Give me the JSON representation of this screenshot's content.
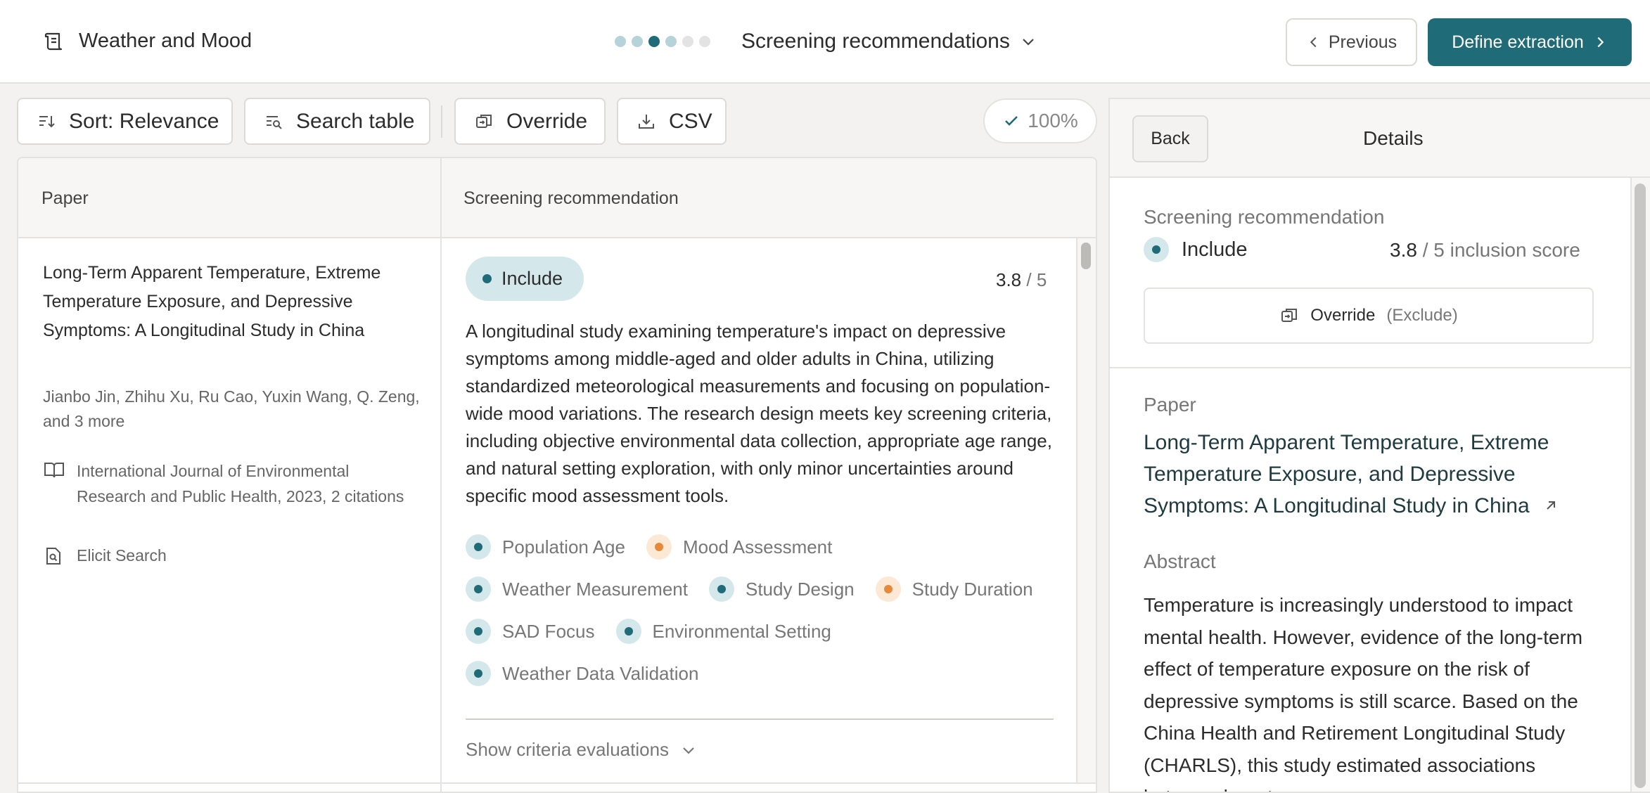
{
  "header": {
    "app_title": "Weather and Mood",
    "stage": "Screening recommendations",
    "steps": [
      "done",
      "done",
      "active",
      "done",
      "todo",
      "todo"
    ],
    "previous_label": "Previous",
    "next_label": "Define extraction"
  },
  "toolbar": {
    "sort_label": "Sort: Relevance",
    "search_label": "Search table",
    "override_label": "Override",
    "csv_label": "CSV",
    "progress": "100%"
  },
  "table": {
    "headers": [
      "Paper",
      "Screening recommendation"
    ],
    "row": {
      "title": "Long-Term Apparent Temperature, Extreme Temperature Exposure, and Depressive Symptoms: A Longitudinal Study in China",
      "authors": "Jianbo Jin, Zhihu Xu, Ru Cao, Yuxin Wang, Q. Zeng, and 3 more",
      "journal": "International Journal of Environmental Research and Public Health, 2023, 2 citations",
      "source": "Elicit Search",
      "recommendation": "Include",
      "score": "3.8",
      "score_max": "/ 5",
      "summary": "A longitudinal study examining temperature's impact on depressive symptoms among middle-aged and older adults in China, utilizing standardized meteorological measurements and focusing on population-wide mood variations. The research design meets key screening criteria, including objective environmental data collection, appropriate age range, and natural setting exploration, with only minor uncertainties around specific mood assessment tools.",
      "criteria": [
        {
          "label": "Population Age",
          "status": "pos"
        },
        {
          "label": "Mood Assessment",
          "status": "neg"
        },
        {
          "label": "Weather Measurement",
          "status": "pos"
        },
        {
          "label": "Study Design",
          "status": "pos"
        },
        {
          "label": "Study Duration",
          "status": "neg"
        },
        {
          "label": "SAD Focus",
          "status": "pos"
        },
        {
          "label": "Environmental Setting",
          "status": "pos"
        },
        {
          "label": "Weather Data Validation",
          "status": "pos"
        }
      ],
      "show_criteria_label": "Show criteria evaluations"
    }
  },
  "details": {
    "back_label": "Back",
    "title": "Details",
    "screening_label": "Screening recommendation",
    "recommendation": "Include",
    "score": "3.8",
    "score_suffix": "/ 5 inclusion score",
    "override_label": "Override",
    "override_alt": "(Exclude)",
    "paper_label": "Paper",
    "paper_title": "Long-Term Apparent Temperature, Extreme Temperature Exposure, and Depressive Symptoms: A Longitudinal Study in China",
    "abstract_label": "Abstract",
    "abstract": "Temperature is increasingly understood to impact mental health. However, evidence of the long-term effect of temperature exposure on the risk of depressive symptoms is still scarce. Based on the China Health and Retirement Longitudinal Study (CHARLS), this study estimated associations between long-term"
  },
  "colors": {
    "accent": "#1f6b77",
    "include_bg": "#d4e8ec",
    "warning": "#e58a3a",
    "warning_bg": "#fbe8d5"
  },
  "icons": [
    "scroll-icon",
    "chevron-down-icon",
    "chevron-left-icon",
    "chevron-right-icon",
    "sort-icon",
    "search-table-icon",
    "override-icon",
    "download-icon",
    "check-icon",
    "book-icon",
    "document-search-icon",
    "external-link-icon"
  ]
}
